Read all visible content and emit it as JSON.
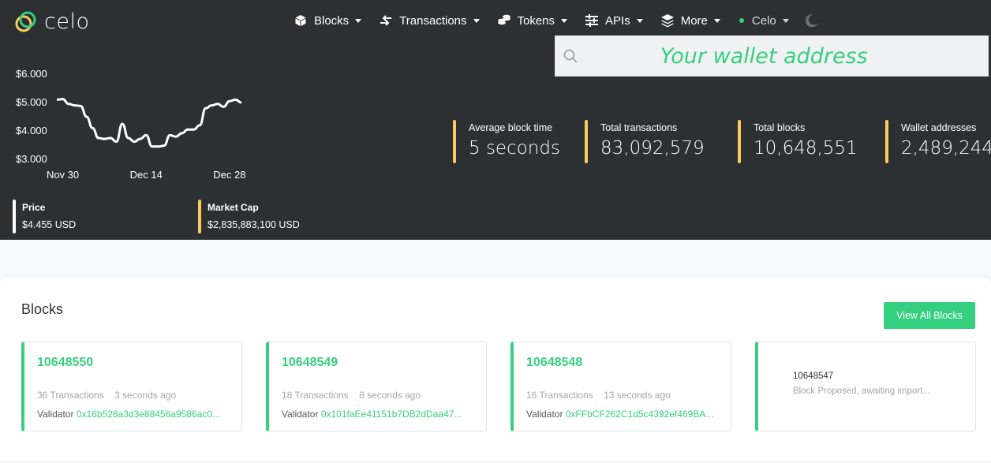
{
  "brand": {
    "name": "celo"
  },
  "nav": {
    "items": [
      {
        "label": "Blocks",
        "icon": "cube-icon"
      },
      {
        "label": "Transactions",
        "icon": "arrows-exchange-icon"
      },
      {
        "label": "Tokens",
        "icon": "coins-icon"
      },
      {
        "label": "APIs",
        "icon": "sliders-icon"
      },
      {
        "label": "More",
        "icon": "layers-icon"
      }
    ],
    "network": "Celo",
    "theme_icon": "moon-icon"
  },
  "search": {
    "placeholder": "Your wallet address"
  },
  "chart_data": {
    "type": "line",
    "title": "",
    "xlabel": "",
    "ylabel": "",
    "y_tick_labels": [
      "$6.000",
      "$5.000",
      "$4.000",
      "$3.000"
    ],
    "x_tick_labels": [
      "Nov 30",
      "Dec 14",
      "Dec 28"
    ],
    "ylim": [
      3.0,
      6.0
    ],
    "x": [
      "Nov 29",
      "Nov 30",
      "Dec 1",
      "Dec 2",
      "Dec 3",
      "Dec 4",
      "Dec 5",
      "Dec 6",
      "Dec 7",
      "Dec 8",
      "Dec 9",
      "Dec 10",
      "Dec 11",
      "Dec 12",
      "Dec 13",
      "Dec 14",
      "Dec 15",
      "Dec 16",
      "Dec 17",
      "Dec 18",
      "Dec 19",
      "Dec 20",
      "Dec 21",
      "Dec 22",
      "Dec 23",
      "Dec 24",
      "Dec 25",
      "Dec 26",
      "Dec 27",
      "Dec 28",
      "Dec 29",
      "Dec 30"
    ],
    "series": [
      {
        "color": "#ffffff",
        "values": [
          5.1,
          5.12,
          4.95,
          4.9,
          4.88,
          4.5,
          4.1,
          3.75,
          3.72,
          3.75,
          3.62,
          4.25,
          3.75,
          3.62,
          3.72,
          3.85,
          3.45,
          3.45,
          3.48,
          3.85,
          3.8,
          3.92,
          4.05,
          4.05,
          4.2,
          4.8,
          4.9,
          4.95,
          4.85,
          5.05,
          5.1,
          5.0
        ]
      }
    ],
    "grid": false
  },
  "price": {
    "label": "Price",
    "value": "$4.455 USD",
    "bar_color": "#ffffff"
  },
  "market_cap": {
    "label": "Market Cap",
    "value": "$2,835,883,100 USD",
    "bar_color": "#fbcc5c"
  },
  "stats": [
    {
      "label": "Average block time",
      "value": "5 seconds"
    },
    {
      "label": "Total transactions",
      "value": "83,092,579"
    },
    {
      "label": "Total blocks",
      "value": "10,648,551"
    },
    {
      "label": "Wallet addresses",
      "value": "2,489,244"
    }
  ],
  "blocks": {
    "title": "Blocks",
    "view_all": "View All Blocks",
    "tiles": [
      {
        "number": "10648550",
        "tx": "36 Transactions",
        "time": "3 seconds ago",
        "validator_label": "Validator",
        "validator": "0x16b528a3d3e88456a9586ac0..."
      },
      {
        "number": "10648549",
        "tx": "18 Transactions",
        "time": "8 seconds ago",
        "validator_label": "Validator",
        "validator": "0x101faEe41151b7DB2dDaa47..."
      },
      {
        "number": "10648548",
        "tx": "16 Transactions",
        "time": "13 seconds ago",
        "validator_label": "Validator",
        "validator": "0xFFbCF262C1d5c4392ef469BA..."
      }
    ],
    "pending": {
      "number": "10648547",
      "status": "Block Proposed, awaiting import..."
    }
  },
  "colors": {
    "accent": "#35d07f",
    "stat_bar": "#fbcc5c",
    "hero_bg": "#2c3033"
  }
}
